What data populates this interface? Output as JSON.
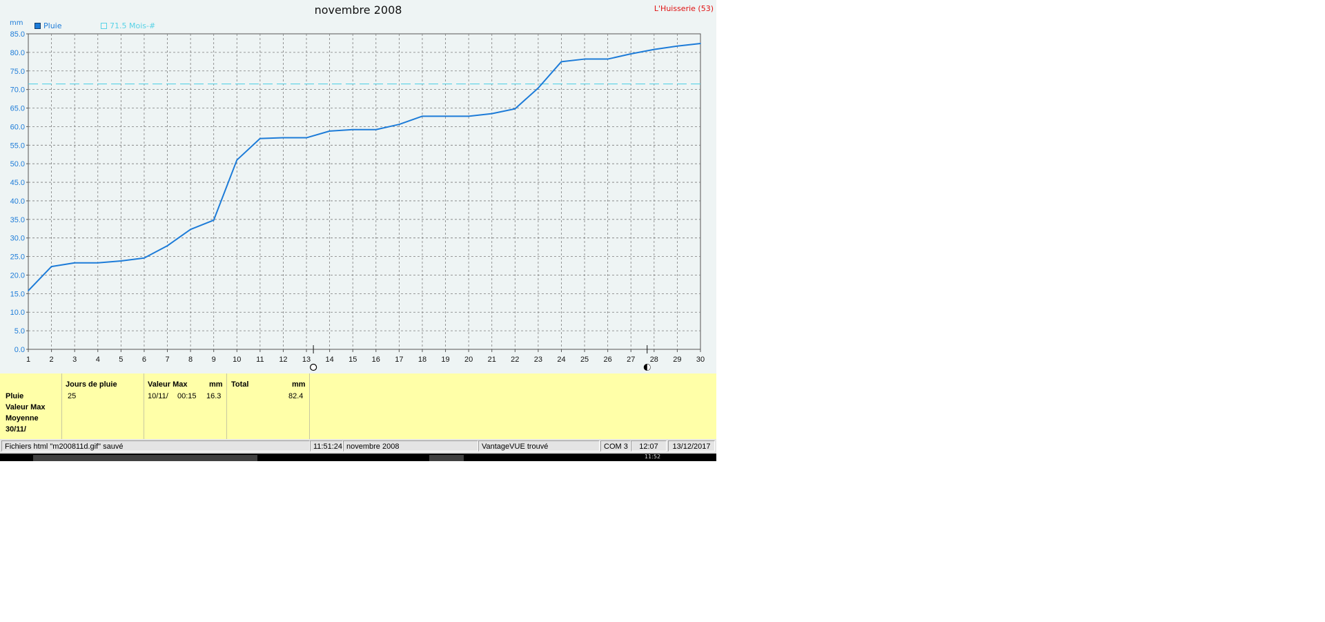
{
  "title": "novembre 2008",
  "location": "L'Huisserie (53)",
  "legend": {
    "series1": "Pluie",
    "series2": "71.5 Mois-#"
  },
  "chart_data": {
    "type": "line",
    "title": "novembre 2008",
    "ylabel": "mm",
    "xlabel": "",
    "x": [
      1,
      2,
      3,
      4,
      5,
      6,
      7,
      8,
      9,
      10,
      11,
      12,
      13,
      14,
      15,
      16,
      17,
      18,
      19,
      20,
      21,
      22,
      23,
      24,
      25,
      26,
      27,
      28,
      29,
      30
    ],
    "series": [
      {
        "name": "Pluie",
        "values": [
          15.8,
          22.3,
          23.3,
          23.3,
          23.8,
          24.6,
          27.9,
          32.3,
          34.8,
          51.0,
          56.8,
          57.0,
          57.0,
          58.8,
          59.2,
          59.2,
          60.6,
          62.8,
          62.8,
          62.8,
          63.5,
          64.8,
          70.4,
          77.5,
          78.2,
          78.2,
          79.6,
          80.8,
          81.7,
          82.4
        ]
      },
      {
        "name": "71.5 Mois-#",
        "values": [
          71.5,
          71.5,
          71.5,
          71.5,
          71.5,
          71.5,
          71.5,
          71.5,
          71.5,
          71.5,
          71.5,
          71.5,
          71.5,
          71.5,
          71.5,
          71.5,
          71.5,
          71.5,
          71.5,
          71.5,
          71.5,
          71.5,
          71.5,
          71.5,
          71.5,
          71.5,
          71.5,
          71.5,
          71.5,
          71.5
        ]
      }
    ],
    "yticks": [
      "0.0",
      "5.0",
      "10.0",
      "15.0",
      "20.0",
      "25.0",
      "30.0",
      "35.0",
      "40.0",
      "45.0",
      "50.0",
      "55.0",
      "60.0",
      "65.0",
      "70.0",
      "75.0",
      "80.0",
      "85.0"
    ],
    "xticks": [
      "1",
      "2",
      "3",
      "4",
      "5",
      "6",
      "7",
      "8",
      "9",
      "10",
      "11",
      "12",
      "13",
      "14",
      "15",
      "16",
      "17",
      "18",
      "19",
      "20",
      "21",
      "22",
      "23",
      "24",
      "25",
      "26",
      "27",
      "28",
      "29",
      "30"
    ],
    "ylim": [
      0,
      85
    ],
    "xlim": [
      1,
      30
    ],
    "grid": true,
    "legend_position": "top-left",
    "colors": {
      "series1": "#1c7bd8",
      "series2": "#58d2e6",
      "axis_text": "#1c7bd8"
    },
    "moon_phases": [
      {
        "x": 13.3,
        "phase": "full-moon"
      },
      {
        "x": 27.7,
        "phase": "new-moon"
      }
    ]
  },
  "stats": {
    "row_labels": [
      "Pluie",
      "Valeur Max",
      "Moyenne",
      "30/11/"
    ],
    "rain_days": {
      "header": "Jours de pluie",
      "value": "25"
    },
    "max_value": {
      "header": "Valeur Max",
      "unit": "mm",
      "date": "10/11/",
      "time": "00:15",
      "value": "16.3"
    },
    "total": {
      "header": "Total",
      "unit": "mm",
      "value": "82.4"
    }
  },
  "statusbar": {
    "message": "Fichiers html  \"m200811d.gif\"  sauvé",
    "time": "11:51:24",
    "period": "novembre 2008",
    "device": "VantageVUE trouvé",
    "port": "COM 3",
    "clock": "12:07",
    "date": "13/12/2017"
  },
  "taskbar": {
    "clock": "11:52"
  }
}
